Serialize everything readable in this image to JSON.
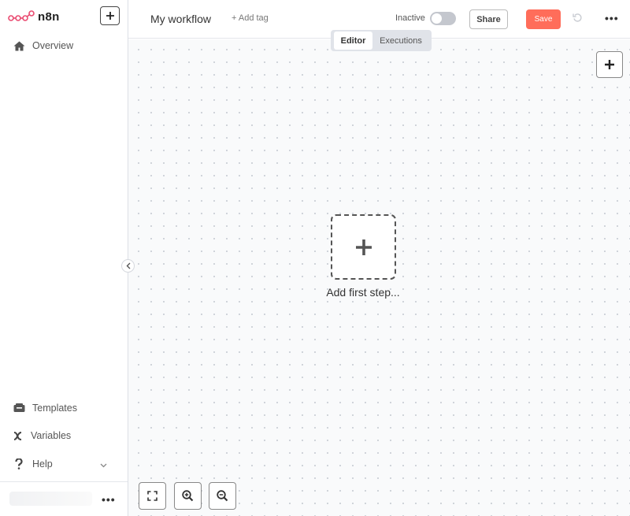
{
  "sidebar": {
    "logo_text": "n8n",
    "top_items": [
      {
        "label": "Overview",
        "icon": "home-icon"
      }
    ],
    "bottom_items": [
      {
        "label": "Templates",
        "icon": "templates-icon"
      },
      {
        "label": "Variables",
        "icon": "variables-icon"
      },
      {
        "label": "Help",
        "icon": "help-icon"
      }
    ],
    "more_label": "•••"
  },
  "header": {
    "workflow_name": "My workflow",
    "add_tag_label": "+ Add tag",
    "status_label": "Inactive",
    "active": false,
    "share_label": "Share",
    "save_label": "Save",
    "more_label": "•••"
  },
  "tabs": [
    {
      "label": "Editor",
      "active": true
    },
    {
      "label": "Executions",
      "active": false
    }
  ],
  "canvas": {
    "add_first_step_label": "Add first step..."
  },
  "colors": {
    "accent": "#ff6d5a",
    "logo": "#ea4b71"
  }
}
